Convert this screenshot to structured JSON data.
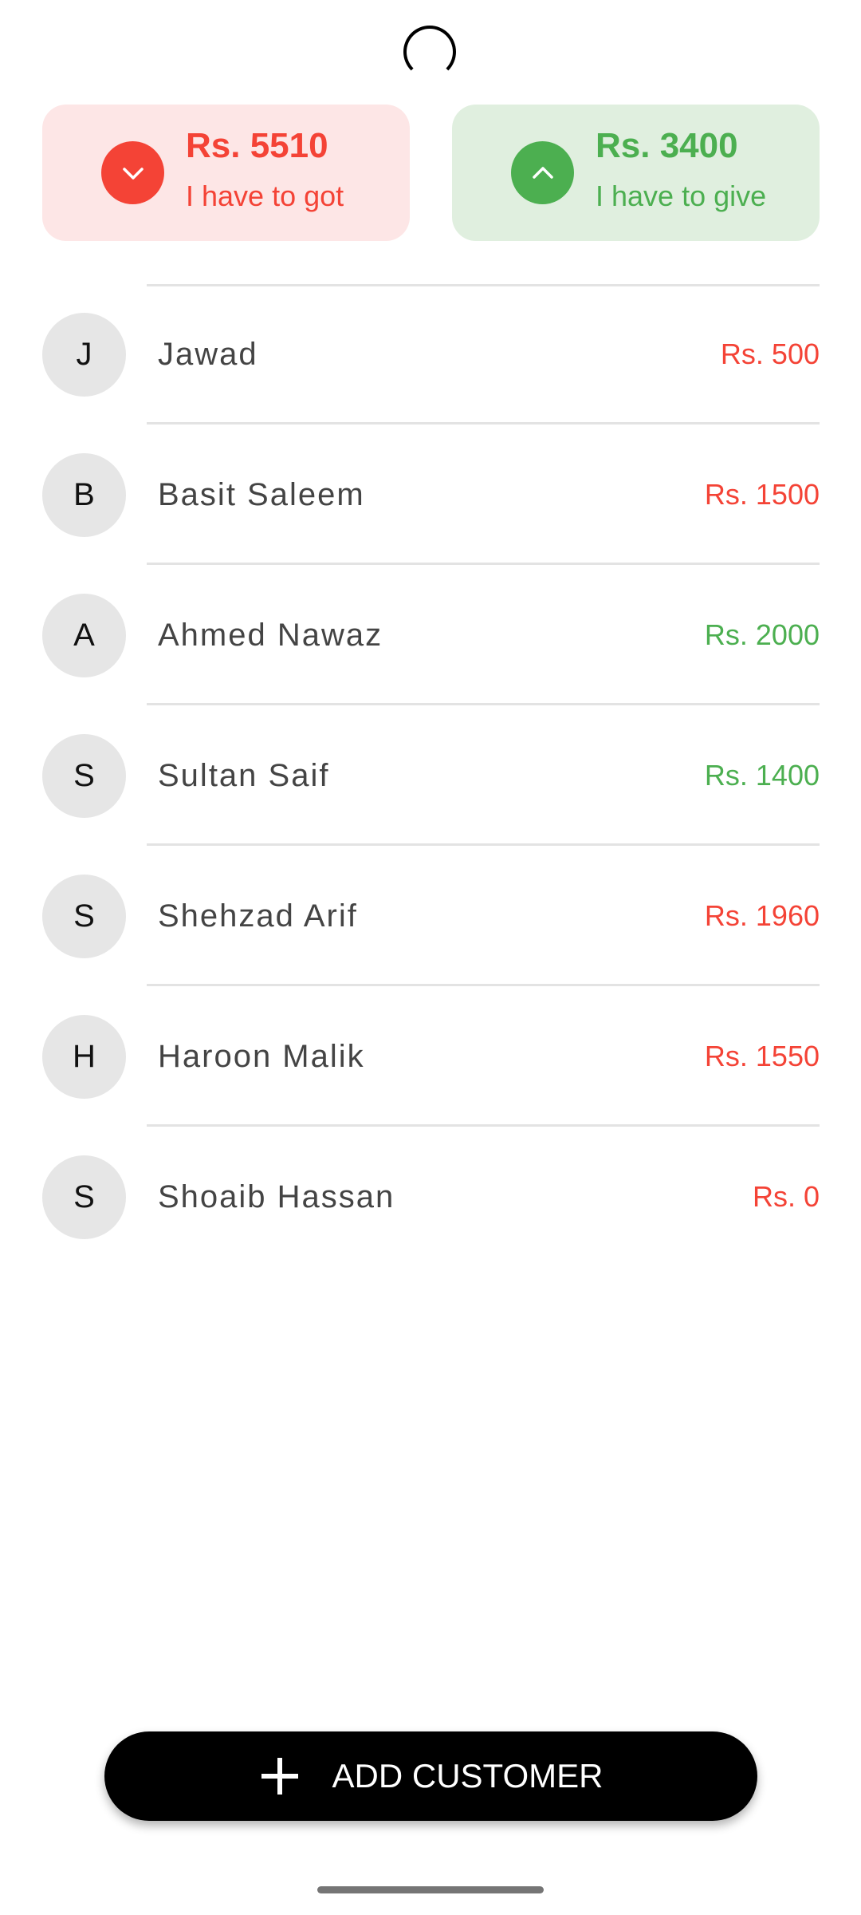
{
  "summary": {
    "receivable": {
      "amount": "Rs. 5510",
      "label": "I have to got",
      "icon": "chevron-down-icon",
      "color": "#f44336"
    },
    "payable": {
      "amount": "Rs. 3400",
      "label": "I have to give",
      "icon": "chevron-up-icon",
      "color": "#4caf50"
    }
  },
  "customers": [
    {
      "initial": "J",
      "name": "Jawad",
      "amount": "Rs. 500",
      "status": "red"
    },
    {
      "initial": "B",
      "name": "Basit Saleem",
      "amount": "Rs. 1500",
      "status": "red"
    },
    {
      "initial": "A",
      "name": "Ahmed Nawaz",
      "amount": "Rs. 2000",
      "status": "green"
    },
    {
      "initial": "S",
      "name": "Sultan Saif",
      "amount": "Rs. 1400",
      "status": "green"
    },
    {
      "initial": "S",
      "name": "Shehzad Arif",
      "amount": "Rs. 1960",
      "status": "red"
    },
    {
      "initial": "H",
      "name": "Haroon Malik",
      "amount": "Rs. 1550",
      "status": "red"
    },
    {
      "initial": "S",
      "name": "Shoaib Hassan",
      "amount": "Rs. 0",
      "status": "red"
    }
  ],
  "add_button": {
    "label": "ADD CUSTOMER",
    "icon": "plus-icon"
  },
  "colors": {
    "red": "#f44336",
    "green": "#4caf50",
    "receivable_bg": "#fde6e6",
    "payable_bg": "#e0efdf"
  }
}
